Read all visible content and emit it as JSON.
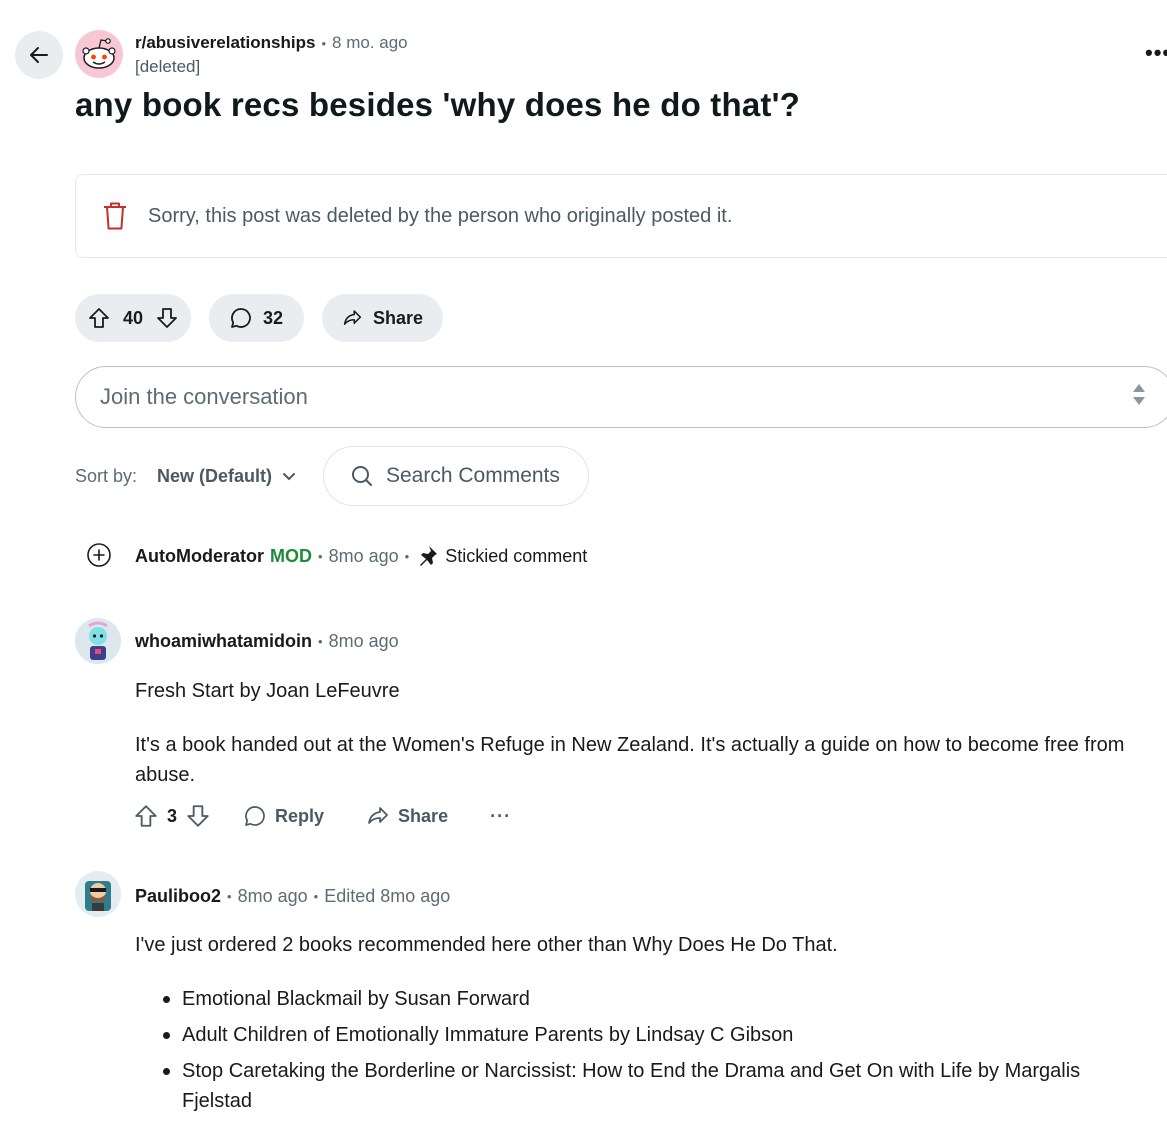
{
  "post": {
    "subreddit": "r/abusiverelationships",
    "time": "8 mo. ago",
    "author": "[deleted]",
    "title": "any book recs besides 'why does he do that'?",
    "deleted_notice": "Sorry, this post was deleted by the person who originally posted it.",
    "votes": "40",
    "comments": "32",
    "share_label": "Share",
    "more_label": "•••"
  },
  "composer": {
    "placeholder": "Join the conversation"
  },
  "sort": {
    "label": "Sort by:",
    "value": "New (Default)"
  },
  "search": {
    "placeholder": "Search Comments"
  },
  "mod_comment": {
    "user": "AutoModerator",
    "tag": "MOD",
    "time": "8mo ago",
    "stickied": "Stickied comment"
  },
  "comments": [
    {
      "user": "whoamiwhatamidoin",
      "time": "8mo ago",
      "paragraphs": [
        "Fresh Start by Joan LeFeuvre",
        "It's a book handed out at the Women's Refuge in New Zealand. It's actually a guide on how to become free from abuse."
      ],
      "votes": "3",
      "reply_label": "Reply",
      "share_label": "Share",
      "more_label": "···"
    },
    {
      "user": "Pauliboo2",
      "time": "8mo ago",
      "edited": "Edited 8mo ago",
      "intro": "I've just ordered 2 books recommended here other than Why Does He Do That.",
      "list": [
        "Emotional Blackmail by Susan Forward",
        "Adult Children of Emotionally Immature Parents by Lindsay C Gibson",
        "Stop Caretaking the Borderline or Narcissist: How to End the Drama and Get On with Life by Margalis Fjelstad"
      ]
    }
  ],
  "colors": {
    "mod_green": "#1f8a3a",
    "pill_bg": "#eaedef",
    "trash_red": "#c4302b",
    "muted_text": "#5c6c74"
  }
}
